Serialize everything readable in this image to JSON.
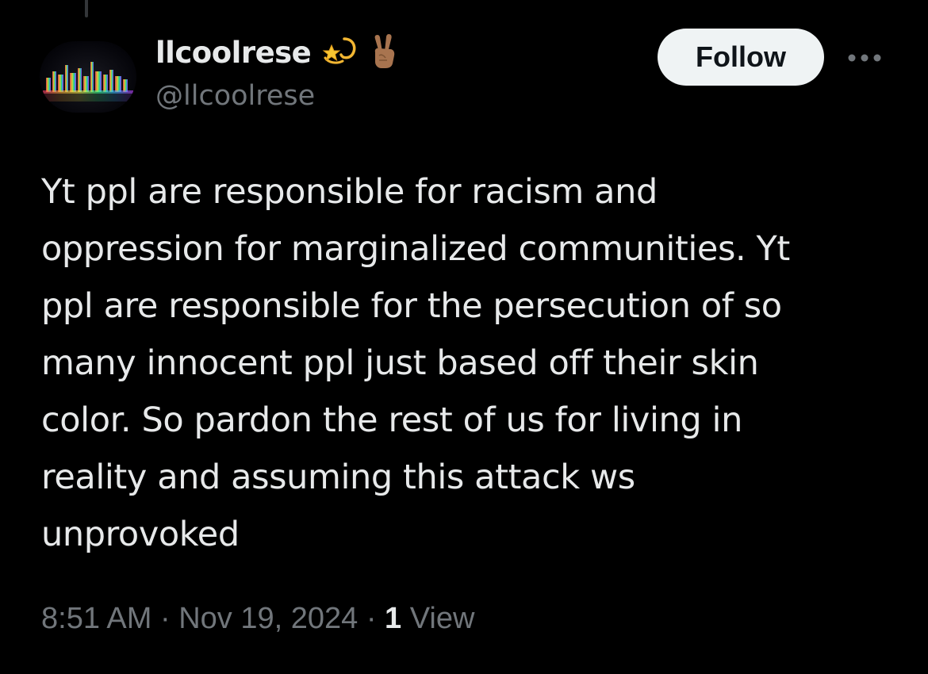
{
  "post": {
    "author": {
      "display_name": "llcoolrese",
      "handle": "@llcoolrese",
      "name_emojis": [
        "dizzy-star-icon",
        "victory-hand-icon"
      ]
    },
    "follow_label": "Follow",
    "more_icon": "more-horizontal-icon",
    "text": "Yt ppl are responsible for racism and\noppression for  marginalized communities. Yt\nppl are responsible for the persecution of so\nmany innocent ppl just based off their skin\ncolor. So pardon the rest of us for living in\nreality and assuming this attack ws\nunprovoked",
    "time": "8:51 AM",
    "separator": " · ",
    "date": "Nov 19, 2024",
    "views_count": "1",
    "views_label": "View"
  },
  "colors": {
    "background": "#000000",
    "primary_text": "#e7e9ea",
    "secondary_text": "#71767b",
    "follow_button_bg": "#eff3f4",
    "follow_button_text": "#0f1419"
  }
}
